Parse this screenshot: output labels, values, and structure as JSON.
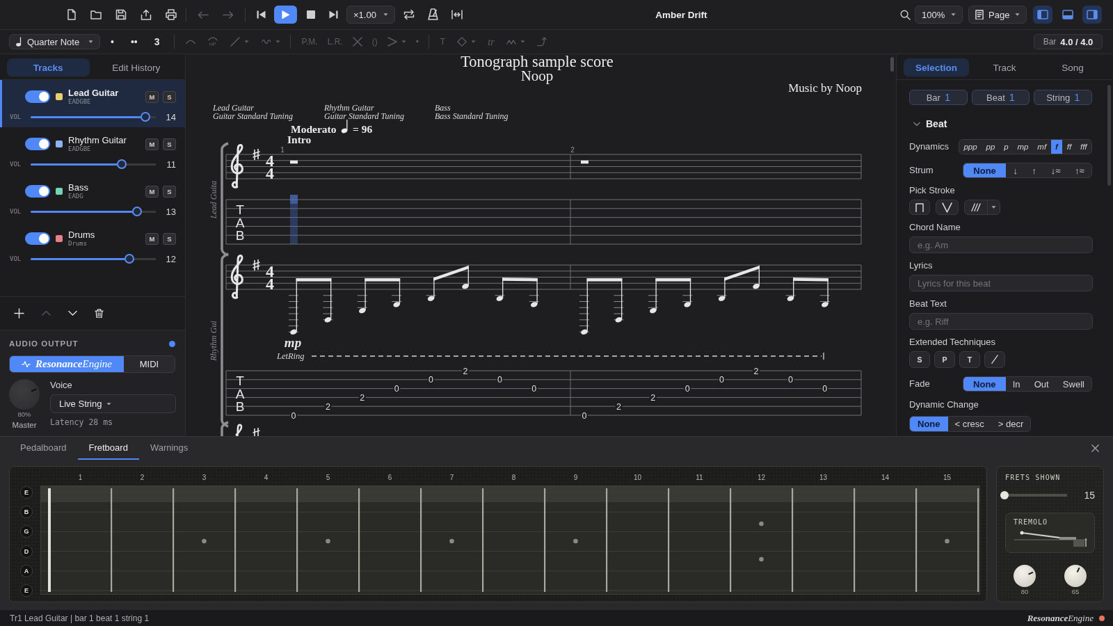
{
  "toolbar": {
    "history": [
      {
        "kind": "undo",
        "disabled": true
      },
      {
        "kind": "redo",
        "disabled": true
      }
    ],
    "speed": "×1.00",
    "title": "Amber Drift",
    "zoom": "100%",
    "view_mode": "Page",
    "panel_toggles": [
      {
        "on": true
      },
      {
        "on": false
      },
      {
        "on": true
      }
    ]
  },
  "note_toolbar": {
    "duration": "Quarter Note",
    "dots": [
      "•",
      "••"
    ],
    "tuplet": "3",
    "tool_groups": [
      [
        {
          "kind": "tie",
          "disabled": true,
          "caret": false
        },
        {
          "kind": "hammer",
          "label": "HP",
          "disabled": true,
          "caret": false
        },
        {
          "kind": "slide",
          "disabled": true,
          "caret": true
        },
        {
          "kind": "vibrato",
          "disabled": true,
          "caret": true
        }
      ],
      [
        {
          "kind": "text",
          "label": "P.M.",
          "disabled": true,
          "caret": false
        },
        {
          "kind": "text",
          "label": "L.R.",
          "disabled": true,
          "caret": false
        },
        {
          "kind": "dead",
          "disabled": true,
          "caret": false
        },
        {
          "kind": "text",
          "label": "()",
          "disabled": true,
          "caret": false
        },
        {
          "kind": "accent",
          "disabled": true,
          "caret": true
        },
        {
          "kind": "text",
          "label": "•",
          "disabled": true,
          "caret": false
        }
      ],
      [
        {
          "kind": "text",
          "label": "T",
          "disabled": true,
          "caret": false
        },
        {
          "kind": "harmonic",
          "disabled": true,
          "caret": true
        },
        {
          "kind": "italic",
          "label": "tr",
          "disabled": true,
          "caret": false
        },
        {
          "kind": "tremolo",
          "disabled": true,
          "caret": true
        },
        {
          "kind": "bend",
          "disabled": true,
          "caret": false
        }
      ]
    ],
    "bar_label": "Bar",
    "bar_value": "4.0 / 4.0"
  },
  "left_panel": {
    "tabs": [
      {
        "label": "Tracks",
        "selected": true
      },
      {
        "label": "Edit History",
        "selected": false
      }
    ],
    "tracks": [
      {
        "name": "Lead Guitar",
        "tuning": "EADGBE",
        "color": "#e8cf6b",
        "enabled": true,
        "selected": true,
        "mute": "M",
        "muted": false,
        "solo": "S",
        "soloed": false,
        "vol_label": "VOL",
        "level": 0.88,
        "volume": "14"
      },
      {
        "name": "Rhythm Guitar",
        "tuning": "EADGBE",
        "color": "#8fb2f2",
        "enabled": true,
        "selected": false,
        "mute": "M",
        "muted": false,
        "solo": "S",
        "soloed": false,
        "vol_label": "VOL",
        "level": 0.69,
        "volume": "11"
      },
      {
        "name": "Bass",
        "tuning": "EADG",
        "color": "#74d4b6",
        "enabled": true,
        "selected": false,
        "mute": "M",
        "muted": false,
        "solo": "S",
        "soloed": false,
        "vol_label": "VOL",
        "level": 0.81,
        "volume": "13"
      },
      {
        "name": "Drums",
        "tuning": "Drums",
        "color": "#e8808c",
        "enabled": true,
        "selected": false,
        "mute": "M",
        "muted": false,
        "solo": "S",
        "soloed": false,
        "vol_label": "VOL",
        "level": 0.75,
        "volume": "12"
      }
    ],
    "track_actions": [
      {
        "kind": "add",
        "disabled": false
      },
      {
        "kind": "up",
        "disabled": true
      },
      {
        "kind": "down",
        "disabled": false
      },
      {
        "kind": "delete",
        "disabled": false
      }
    ],
    "audio_output": {
      "title": "AUDIO OUTPUT",
      "active": true,
      "engines": [
        {
          "kind": "engine",
          "label": "**Resonance**Engine",
          "selected": true
        },
        {
          "kind": "plain",
          "label": "MIDI",
          "selected": false
        }
      ],
      "master": {
        "value": "80%",
        "label": "Master",
        "level": 0.8
      },
      "voice_label": "Voice",
      "voice": "Live String",
      "latency": "Latency 28 ms"
    }
  },
  "score": {
    "title": "Tonograph sample score",
    "subtitle": "Noop",
    "credit": "Music by Noop",
    "track_headers": [
      {
        "name": "Lead Guitar",
        "tuning": "Guitar Standard Tuning"
      },
      {
        "name": "Rhythm Guitar",
        "tuning": "Guitar Standard Tuning"
      },
      {
        "name": "Bass",
        "tuning": "Bass Standard Tuning"
      }
    ],
    "tempo": {
      "marking": "Moderato",
      "value": "= 96"
    },
    "section": "Intro",
    "bar_numbers": [
      "1",
      "2"
    ],
    "staves": [
      {
        "label": "Lead Guita",
        "time": [
          "4",
          "4"
        ],
        "tab_letters": [
          "T",
          "A",
          "B"
        ],
        "bars": [
          {
            "kind": "rest",
            "selected": true
          },
          {
            "kind": "rest",
            "selected": false
          }
        ]
      },
      {
        "label": "Rhythm Gui",
        "time": [
          "4",
          "4"
        ],
        "tab_letters": [
          "T",
          "A",
          "B"
        ],
        "dynamic": "mp",
        "let_ring": "LetRing",
        "bars": [
          {
            "kind": "notes",
            "selected": false,
            "notes": [
              {
                "string_6": "0"
              },
              {
                "string_5": "2"
              },
              {
                "string_4": "2"
              },
              {
                "string_3": "0"
              },
              {
                "string_2": "0"
              },
              {
                "string_1": "2"
              },
              {
                "string_2": "0"
              },
              {
                "string_3": "0"
              }
            ]
          },
          {
            "kind": "notes",
            "selected": false,
            "notes": [
              {
                "string_6": "0"
              },
              {
                "string_5": "2"
              },
              {
                "string_4": "2"
              },
              {
                "string_3": "0"
              },
              {
                "string_2": "0"
              },
              {
                "string_1": "2"
              },
              {
                "string_2": "0"
              },
              {
                "string_3": "0"
              }
            ]
          }
        ]
      }
    ]
  },
  "right_panel": {
    "tabs": [
      {
        "label": "Selection",
        "selected": true
      },
      {
        "label": "Track",
        "selected": false
      },
      {
        "label": "Song",
        "selected": false
      }
    ],
    "position": [
      {
        "label": "Bar",
        "value": "1"
      },
      {
        "label": "Beat",
        "value": "1"
      },
      {
        "label": "String",
        "value": "1"
      }
    ],
    "section": {
      "title": "Beat",
      "expanded": true
    },
    "rows": [
      {
        "kind": "dynamics",
        "label": "Dynamics",
        "options": [
          {
            "label": "ppp",
            "selected": false
          },
          {
            "label": "pp",
            "selected": false
          },
          {
            "label": "p",
            "selected": false
          },
          {
            "label": "mp",
            "selected": false
          },
          {
            "label": "mf",
            "selected": false
          },
          {
            "label": "f",
            "selected": true
          },
          {
            "label": "ff",
            "selected": false
          },
          {
            "label": "fff",
            "selected": false
          }
        ]
      },
      {
        "kind": "segmented",
        "label": "Strum",
        "options": [
          {
            "label": "None",
            "selected": true
          },
          {
            "label": "↓",
            "selected": false
          },
          {
            "label": "↑",
            "selected": false
          },
          {
            "label": "↓≈",
            "selected": false
          },
          {
            "label": "↑≈",
            "selected": false
          }
        ]
      },
      {
        "kind": "stroke",
        "label": "Pick Stroke",
        "buttons": [
          {
            "kind": "down",
            "caret": false
          },
          {
            "kind": "up",
            "caret": false
          },
          {
            "kind": "slashes",
            "caret": true
          }
        ]
      },
      {
        "kind": "input",
        "label": "Chord Name",
        "placeholder": "e.g. Am"
      },
      {
        "kind": "input",
        "label": "Lyrics",
        "placeholder": "Lyrics for this beat"
      },
      {
        "kind": "input",
        "label": "Beat Text",
        "placeholder": "e.g. Riff"
      },
      {
        "kind": "techniques",
        "label": "Extended Techniques",
        "buttons": [
          {
            "kind": "text",
            "label": "S"
          },
          {
            "kind": "text",
            "label": "P"
          },
          {
            "kind": "text",
            "label": "T"
          },
          {
            "kind": "slash"
          }
        ]
      },
      {
        "kind": "segmented",
        "label": "Fade",
        "options": [
          {
            "label": "None",
            "selected": true
          },
          {
            "label": "In",
            "selected": false
          },
          {
            "label": "Out",
            "selected": false
          },
          {
            "label": "Swell",
            "selected": false
          }
        ]
      },
      {
        "kind": "stacked-segmented",
        "label": "Dynamic Change",
        "options": [
          {
            "label": "None",
            "selected": true
          },
          {
            "label": "< cresc",
            "selected": false
          },
          {
            "label": "> decr",
            "selected": false
          }
        ]
      }
    ]
  },
  "bottom_panel": {
    "tabs": [
      {
        "label": "Pedalboard",
        "selected": false
      },
      {
        "label": "Fretboard",
        "selected": true
      },
      {
        "label": "Warnings",
        "selected": false
      }
    ],
    "fretboard": {
      "frets": [
        {
          "label": "1",
          "kind": "plain"
        },
        {
          "label": "2",
          "kind": "plain"
        },
        {
          "label": "3",
          "kind": "dot"
        },
        {
          "label": "4",
          "kind": "plain"
        },
        {
          "label": "5",
          "kind": "dot"
        },
        {
          "label": "6",
          "kind": "plain"
        },
        {
          "label": "7",
          "kind": "dot"
        },
        {
          "label": "8",
          "kind": "plain"
        },
        {
          "label": "9",
          "kind": "dot"
        },
        {
          "label": "10",
          "kind": "plain"
        },
        {
          "label": "11",
          "kind": "plain"
        },
        {
          "label": "12",
          "kind": "double"
        },
        {
          "label": "13",
          "kind": "plain"
        },
        {
          "label": "14",
          "kind": "plain"
        },
        {
          "label": "15",
          "kind": "dot"
        }
      ],
      "strings": [
        {
          "label": "E",
          "selected": true
        },
        {
          "label": "B",
          "selected": false
        },
        {
          "label": "G",
          "selected": false
        },
        {
          "label": "D",
          "selected": false
        },
        {
          "label": "A",
          "selected": false
        },
        {
          "label": "E",
          "selected": false
        }
      ]
    },
    "settings": {
      "title": "FRETS SHOWN",
      "level": 0,
      "value": "15",
      "tremolo": "TREMOLO",
      "knobs": [
        {
          "value": "80",
          "level": 0.8
        },
        {
          "value": "65",
          "level": 0.65
        }
      ]
    }
  },
  "status_bar": {
    "text": "Tr1 Lead Guitar | bar 1 beat 1 string 1",
    "engine": "**Resonance**Engine",
    "active": true
  }
}
